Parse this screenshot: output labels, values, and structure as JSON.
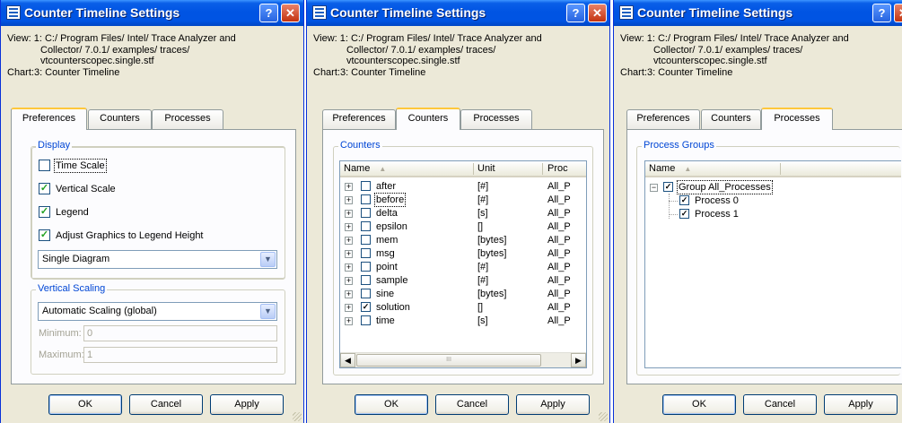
{
  "windows": [
    {
      "title": "Counter Timeline Settings",
      "info": {
        "view_line1": "View: 1: C:/ Program Files/ Intel/ Trace Analyzer and",
        "view_line2": "Collector/ 7.0.1/ examples/ traces/",
        "view_line3": "vtcounterscopec.single.stf",
        "chart": "Chart:3: Counter Timeline"
      },
      "tabs": [
        "Preferences",
        "Counters",
        "Processes"
      ],
      "active_tab": "Preferences",
      "display": {
        "legend": "Display",
        "time_scale": "Time Scale",
        "vertical_scale": "Vertical Scale",
        "legend_option": "Legend",
        "adjust_graphics": "Adjust Graphics to Legend Height",
        "diagram_select": "Single Diagram"
      },
      "vertical_scaling": {
        "legend": "Vertical Scaling",
        "scaling_select": "Automatic Scaling (global)",
        "minimum_label": "Minimum:",
        "minimum_value": "0",
        "maximum_label": "Maximum:",
        "maximum_value": "1"
      },
      "buttons": {
        "ok": "OK",
        "cancel": "Cancel",
        "apply": "Apply"
      }
    },
    {
      "title": "Counter Timeline Settings",
      "info": {
        "view_line1": "View: 1: C:/ Program Files/ Intel/ Trace Analyzer and",
        "view_line2": "Collector/ 7.0.1/ examples/ traces/",
        "view_line3": "vtcounterscopec.single.stf",
        "chart": "Chart:3: Counter Timeline"
      },
      "tabs": [
        "Preferences",
        "Counters",
        "Processes"
      ],
      "active_tab": "Counters",
      "counters": {
        "legend": "Counters",
        "columns": {
          "name": "Name",
          "unit": "Unit",
          "proc": "Proc"
        },
        "rows": [
          {
            "name": "after",
            "unit": "[#]",
            "proc": "All_P",
            "checked": false
          },
          {
            "name": "before",
            "unit": "[#]",
            "proc": "All_P",
            "checked": false
          },
          {
            "name": "delta",
            "unit": "[s]",
            "proc": "All_P",
            "checked": false
          },
          {
            "name": "epsilon",
            "unit": "[]",
            "proc": "All_P",
            "checked": false
          },
          {
            "name": "mem",
            "unit": "[bytes]",
            "proc": "All_P",
            "checked": false
          },
          {
            "name": "msg",
            "unit": "[bytes]",
            "proc": "All_P",
            "checked": false
          },
          {
            "name": "point",
            "unit": "[#]",
            "proc": "All_P",
            "checked": false
          },
          {
            "name": "sample",
            "unit": "[#]",
            "proc": "All_P",
            "checked": false
          },
          {
            "name": "sine",
            "unit": "[bytes]",
            "proc": "All_P",
            "checked": false
          },
          {
            "name": "solution",
            "unit": "[]",
            "proc": "All_P",
            "checked": true
          },
          {
            "name": "time",
            "unit": "[s]",
            "proc": "All_P",
            "checked": false
          }
        ]
      },
      "buttons": {
        "ok": "OK",
        "cancel": "Cancel",
        "apply": "Apply"
      }
    },
    {
      "title": "Counter Timeline Settings",
      "info": {
        "view_line1": "View: 1: C:/ Program Files/ Intel/ Trace Analyzer and",
        "view_line2": "Collector/ 7.0.1/ examples/ traces/",
        "view_line3": "vtcounterscopec.single.stf",
        "chart": "Chart:3: Counter Timeline"
      },
      "tabs": [
        "Preferences",
        "Counters",
        "Processes"
      ],
      "active_tab": "Processes",
      "process_groups": {
        "legend": "Process Groups",
        "columns": {
          "name": "Name"
        },
        "group": {
          "name": "Group All_Processes",
          "checked": true
        },
        "children": [
          {
            "name": "Process 0",
            "checked": true
          },
          {
            "name": "Process 1",
            "checked": true
          }
        ]
      },
      "buttons": {
        "ok": "OK",
        "cancel": "Cancel",
        "apply": "Apply"
      }
    }
  ]
}
